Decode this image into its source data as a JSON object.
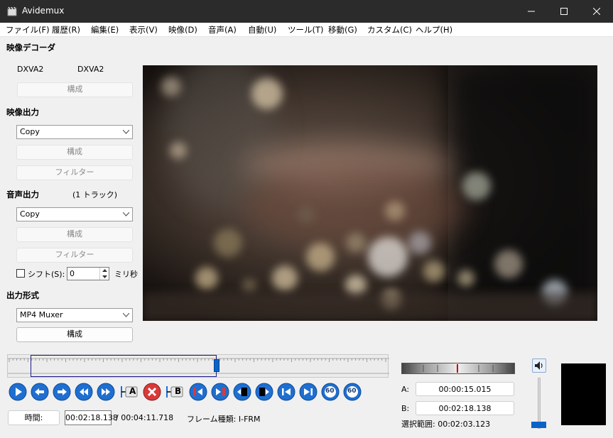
{
  "window": {
    "title": "Avidemux"
  },
  "menu": [
    "ファイル(F)",
    "履歴(R)",
    "編集(E)",
    "表示(V)",
    "映像(D)",
    "音声(A)",
    "自動(U)",
    "ツール(T)",
    "移動(G)",
    "カスタム(C)",
    "ヘルプ(H)"
  ],
  "video_decoder": {
    "title": "映像デコーダ",
    "decoder_left": "DXVA2",
    "decoder_right": "DXVA2",
    "config_label": "構成"
  },
  "video_output": {
    "title": "映像出力",
    "codec": "Copy",
    "config_label": "構成",
    "filter_label": "フィルター"
  },
  "audio_output": {
    "title": "音声出力",
    "tracks": "(1 トラック)",
    "codec": "Copy",
    "config_label": "構成",
    "filter_label": "フィルター",
    "shift_label": "シフト(S):",
    "shift_value": "0",
    "shift_unit": "ミリ秒"
  },
  "output_format": {
    "title": "出力形式",
    "muxer": "MP4 Muxer",
    "config_label": "構成"
  },
  "transport": {
    "goto_a_label": "A",
    "goto_b_label": "B",
    "fps1": "60",
    "fps2": "60"
  },
  "status": {
    "time_button": "時間:",
    "current_time": "00:02:18.138",
    "total_time": "/ 00:04:11.718",
    "frame_type": "フレーム種類: I-FRM"
  },
  "selection": {
    "a_label": "A:",
    "a_time": "00:00:15.015",
    "b_label": "B:",
    "b_time": "00:02:18.138",
    "range_label": "選択範囲: 00:02:03.123"
  },
  "timeline": {
    "position_fraction": 0.549,
    "selection_start_fraction": 0.06,
    "selection_end_fraction": 0.549
  },
  "volume": {
    "level_fraction": 0.02
  },
  "colors": {
    "accent": "#0a64c8",
    "titlebar": "#2b2b2b"
  }
}
